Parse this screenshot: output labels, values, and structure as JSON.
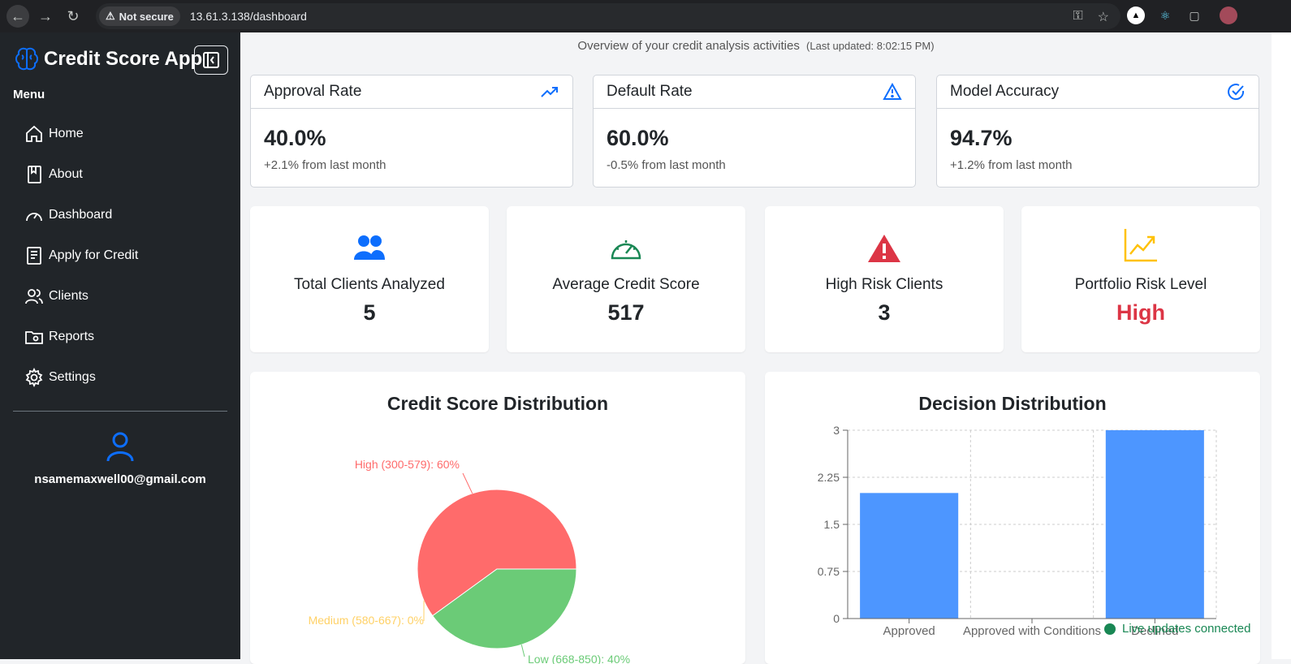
{
  "browser": {
    "security_label": "Not secure",
    "url": "13.61.3.138/dashboard"
  },
  "sidebar": {
    "brand": "Credit Score App",
    "menu_title": "Menu",
    "items": [
      {
        "label": "Home",
        "icon": "home-icon"
      },
      {
        "label": "About",
        "icon": "book-icon"
      },
      {
        "label": "Dashboard",
        "icon": "speedometer-icon"
      },
      {
        "label": "Apply for Credit",
        "icon": "form-icon"
      },
      {
        "label": "Clients",
        "icon": "users-icon"
      },
      {
        "label": "Reports",
        "icon": "folder-icon"
      },
      {
        "label": "Settings",
        "icon": "gear-icon"
      }
    ],
    "user_email": "nsamemaxwell00@gmail.com"
  },
  "overview": {
    "text": "Overview of your credit analysis activities",
    "updated": "(Last updated: 8:02:15 PM)"
  },
  "metrics": [
    {
      "title": "Approval Rate",
      "value": "40.0%",
      "sub": "+2.1% from last month",
      "icon": "trending-up-icon"
    },
    {
      "title": "Default Rate",
      "value": "60.0%",
      "sub": "-0.5% from last month",
      "icon": "warning-icon"
    },
    {
      "title": "Model Accuracy",
      "value": "94.7%",
      "sub": "+1.2% from last month",
      "icon": "check-circle-icon"
    }
  ],
  "stats": [
    {
      "label": "Total Clients Analyzed",
      "value": "5",
      "icon": "users-icon"
    },
    {
      "label": "Average Credit Score",
      "value": "517",
      "icon": "speedometer-icon"
    },
    {
      "label": "High Risk Clients",
      "value": "3",
      "icon": "danger-triangle-icon"
    },
    {
      "label": "Portfolio Risk Level",
      "value": "High",
      "icon": "graph-up-icon"
    }
  ],
  "colors": {
    "accent": "#0d6efd",
    "danger": "#dc3545",
    "success": "#198754",
    "warning": "#ffc107",
    "pie_high": "#ff6b6b",
    "pie_medium": "#ffd166",
    "pie_low": "#6bcb77",
    "bar": "#4d96ff"
  },
  "chart_data": [
    {
      "type": "pie",
      "title": "Credit Score Distribution",
      "categories": [
        "High (300-579)",
        "Medium (580-667)",
        "Low (668-850)"
      ],
      "values": [
        60,
        0,
        40
      ],
      "labels": [
        "High (300-579): 60%",
        "Medium (580-667): 0%",
        "Low (668-850): 40%"
      ]
    },
    {
      "type": "bar",
      "title": "Decision Distribution",
      "categories": [
        "Approved",
        "Approved with Conditions",
        "Declined"
      ],
      "values": [
        2,
        0,
        3
      ],
      "yticks": [
        "0",
        "0.75",
        "1.5",
        "2.25",
        "3"
      ],
      "ylim": [
        0,
        3
      ],
      "grid": true
    }
  ],
  "live_status": "Live updates connected"
}
